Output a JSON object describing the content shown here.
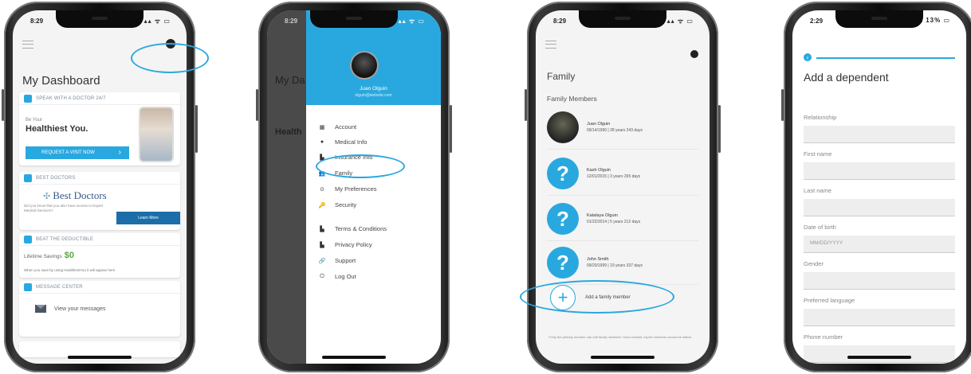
{
  "phone1": {
    "time": "8:29",
    "signal": "▴▴ ᯤ ▭",
    "title": "My Dashboard",
    "speak": {
      "header": "SPEAK WITH A DOCTOR 24/7",
      "sub": "Be Your",
      "big": "Healthiest You.",
      "button": "REQUEST A VISIT NOW"
    },
    "best": {
      "header": "BEST DOCTORS",
      "logo": "Best Doctors",
      "text": "Did you know that you also have access to Expert Medical Services?",
      "button": "Learn More"
    },
    "deductible": {
      "header": "BEAT THE DEDUCTIBLE",
      "label": "Lifetime Savings",
      "amount": "$0",
      "note": "When you save by using HealthiestYou it will appear here"
    },
    "messages": {
      "header": "MESSAGE CENTER",
      "item": "View your messages"
    }
  },
  "phone2": {
    "time": "8:29",
    "signal": "▴▴ ᯤ ▭",
    "name": "Juan Olguin",
    "email": "olguin@website.com",
    "menu": [
      "Account",
      "Medical Info",
      "Insurance Info",
      "Family",
      "My Preferences",
      "Security",
      "Terms & Conditions",
      "Privacy Policy",
      "Support",
      "Log Out"
    ],
    "icons": [
      "▦",
      "●",
      "▙",
      "👥",
      "⊙",
      "🔑",
      "▙",
      "▙",
      "🔗",
      "⏻"
    ],
    "ghost_title": "My Da",
    "ghost_big": "Health"
  },
  "phone3": {
    "time": "8:29",
    "signal": "▴▴ ᯤ ▭",
    "title": "Family",
    "subtitle": "Family Members",
    "members": [
      {
        "name": "Juan Olguin",
        "date": "09/14/1990 | 28 years 243 days"
      },
      {
        "name": "Kash Olguin",
        "date": "12/01/2015 | 3 years 265 days"
      },
      {
        "name": "Katalaya Olguin",
        "date": "01/22/2014 | 5 years 212 days"
      },
      {
        "name": "John Smith",
        "date": "09/20/1999 | 19 years 337 days"
      }
    ],
    "add_label": "Add a family member",
    "footnote": "*Only the primary member can edit family members' Once created, expert members cannot be edited"
  },
  "phone4": {
    "time": "2:29",
    "signal": "▴ 13% ▭",
    "title": "Add a dependent",
    "fields": [
      {
        "label": "Relationship",
        "value": ""
      },
      {
        "label": "First name",
        "value": ""
      },
      {
        "label": "Last name",
        "value": ""
      },
      {
        "label": "Date of birth",
        "value": "MM/DD/YYYY"
      },
      {
        "label": "Gender",
        "value": ""
      },
      {
        "label": "Preferred language",
        "value": ""
      },
      {
        "label": "Phone number",
        "value": ""
      }
    ]
  },
  "colors": {
    "accent": "#29a8df",
    "highlight": "#29a8df",
    "savings": "#5aa845"
  }
}
